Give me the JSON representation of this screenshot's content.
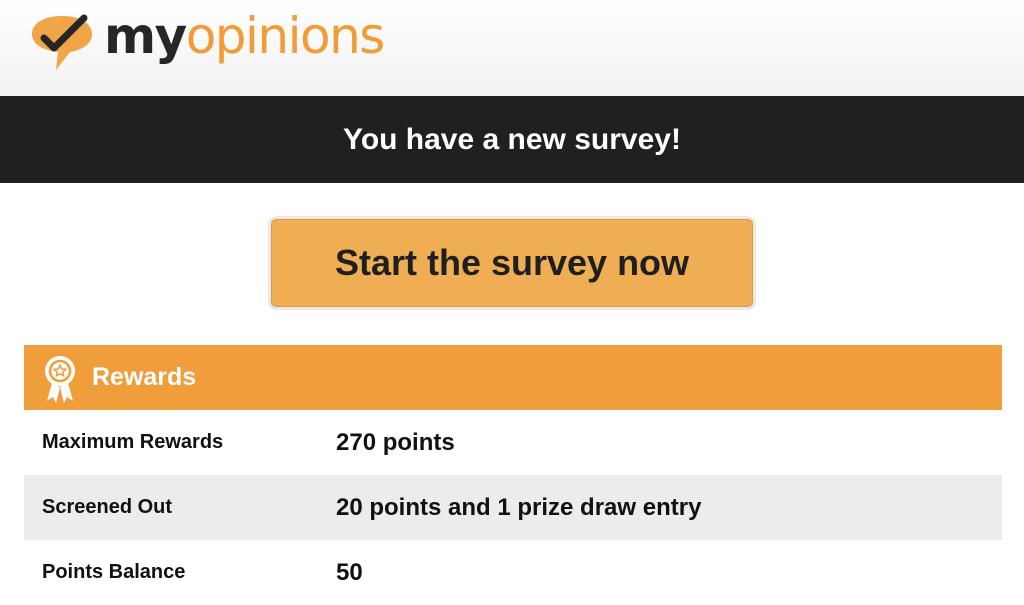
{
  "brand": {
    "logo_part1": "my",
    "logo_part2": "opinions",
    "accent_color": "#f09e3c"
  },
  "banner": {
    "text": "You have a new survey!"
  },
  "cta": {
    "label": "Start the survey now"
  },
  "rewards": {
    "icon": "award-ribbon-icon",
    "title": "Rewards",
    "rows": [
      {
        "label": "Maximum Rewards",
        "value": "270 points"
      },
      {
        "label": "Screened Out",
        "value": "20 points and 1 prize draw entry"
      },
      {
        "label": "Points Balance",
        "value": "50"
      }
    ]
  }
}
